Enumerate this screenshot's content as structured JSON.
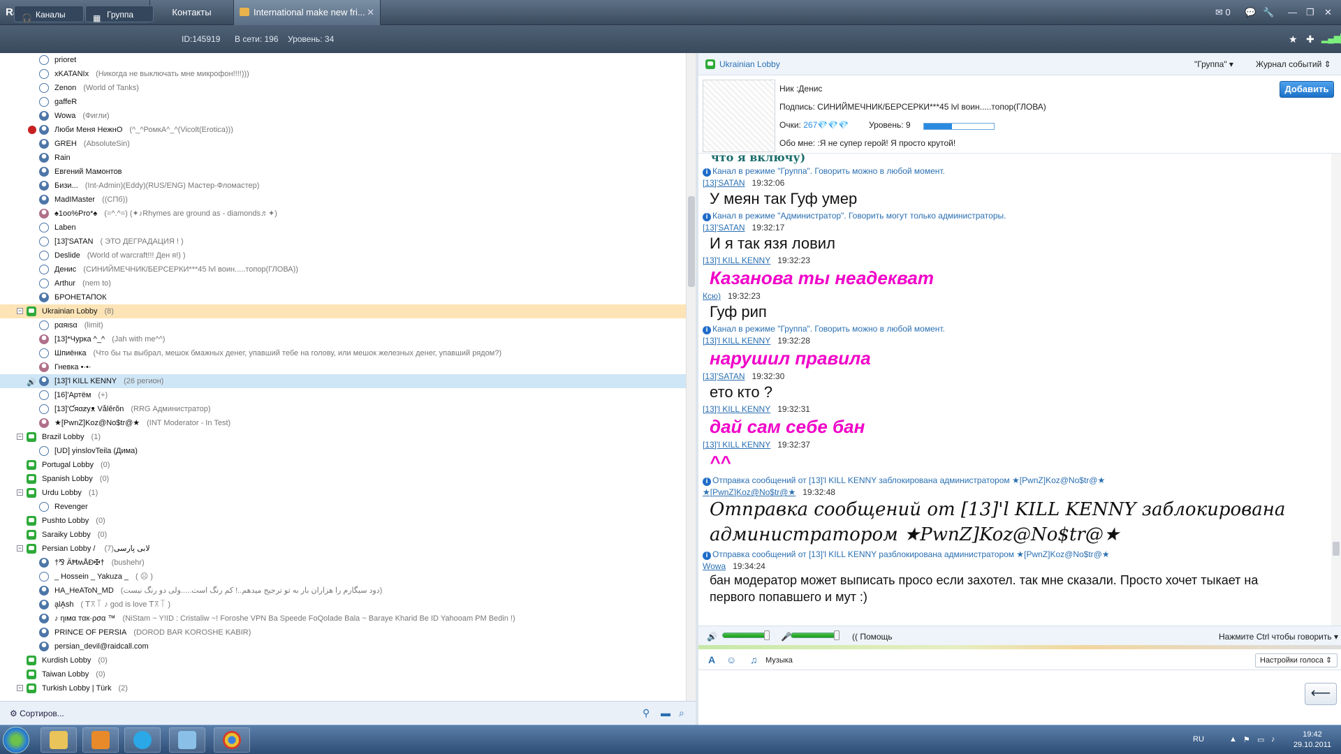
{
  "app": {
    "logo": "RaidCall"
  },
  "tabs": [
    {
      "label": "Группы"
    },
    {
      "label": "Контакты"
    },
    {
      "label": "International make new fri..."
    }
  ],
  "header_icons": {
    "mail_count": "0"
  },
  "sub": {
    "channels_label": "Каналы",
    "group_label": "Группа",
    "id": "ID:145919",
    "online": "В сети: 196",
    "level": "Уровень: 34"
  },
  "tree": [
    {
      "type": "user",
      "indent": 2,
      "style": "o",
      "name": "prioret",
      "note": ""
    },
    {
      "type": "user",
      "indent": 2,
      "style": "o",
      "name": "xKATANIx",
      "note": "(Никогда не выключать мне микрофон!!!!)))"
    },
    {
      "type": "user",
      "indent": 2,
      "style": "o",
      "name": "Zenon",
      "note": "(World of Tanks)"
    },
    {
      "type": "user",
      "indent": 2,
      "style": "o",
      "name": "gaffeR",
      "note": ""
    },
    {
      "type": "user",
      "indent": 2,
      "style": "",
      "name": "Wowa",
      "note": "(Фигли)"
    },
    {
      "type": "user",
      "indent": 2,
      "style": "",
      "name": "Люби Меня НежнО",
      "note": "(^_^РомкА^_^(Vicolt(Erotica)))",
      "blocked": true
    },
    {
      "type": "user",
      "indent": 2,
      "style": "",
      "name": "GREH",
      "note": "(AbsoluteSin)"
    },
    {
      "type": "user",
      "indent": 2,
      "style": "",
      "name": "Rain",
      "note": ""
    },
    {
      "type": "user",
      "indent": 2,
      "style": "",
      "name": "Евгений Мамонтов",
      "note": ""
    },
    {
      "type": "user",
      "indent": 2,
      "style": "",
      "name": "Бизи...",
      "note": "(Int-Admin)(Eddy)(RUS/ENG) Мастер-Фломастер)"
    },
    {
      "type": "user",
      "indent": 2,
      "style": "",
      "name": "MadIMaster",
      "note": "((СПб))"
    },
    {
      "type": "user",
      "indent": 2,
      "style": "p",
      "name": "♠1oo%Pro*♠",
      "note": "(=^.^=) (✦♪Rhymes are ground as - diamonds♬✦)"
    },
    {
      "type": "user",
      "indent": 2,
      "style": "o",
      "name": "Laben",
      "note": ""
    },
    {
      "type": "user",
      "indent": 2,
      "style": "o",
      "name": "[13]'SATAN",
      "note": "( ЭТО ДЕГРАДАЦИЯ ! )"
    },
    {
      "type": "user",
      "indent": 2,
      "style": "o",
      "name": "Deslide",
      "note": "(World of warcraft!!! Ден я!) )"
    },
    {
      "type": "user",
      "indent": 2,
      "style": "o",
      "name": "Денис",
      "note": "(СИНИЙМЕЧНИК/БЕРСЕРКИ***45 lvl воин.....топор(ГЛОВА))"
    },
    {
      "type": "user",
      "indent": 2,
      "style": "o",
      "name": "Arthur",
      "note": "(nem to)"
    },
    {
      "type": "user",
      "indent": 2,
      "style": "",
      "name": "БРОНЕТАПОК",
      "note": ""
    },
    {
      "type": "channel",
      "indent": 1,
      "name": "Ukrainian Lobby",
      "note": "(8)",
      "tw": "⊟",
      "hl": true
    },
    {
      "type": "user",
      "indent": 2,
      "style": "o",
      "name": "рαяιѕα",
      "note": "(limit)"
    },
    {
      "type": "user",
      "indent": 2,
      "style": "p",
      "name": "[13]*Чурка ^_^",
      "note": "(Jah with me^^)"
    },
    {
      "type": "user",
      "indent": 2,
      "style": "o",
      "name": "Шпиёнка",
      "note": "(Что бы ты выбрал, мешок бмажных денег, упавший тебе на голову, или мешок железных денег, упавший рядом?)"
    },
    {
      "type": "user",
      "indent": 2,
      "style": "p",
      "name": "Гневка •·•·",
      "note": ""
    },
    {
      "type": "user",
      "indent": 2,
      "style": "",
      "name": "[13]'l KILL KENNY",
      "note": "(26 регион)",
      "sel": true,
      "speaking": true
    },
    {
      "type": "user",
      "indent": 2,
      "style": "o",
      "name": "[16]'Артём",
      "note": "(+)"
    },
    {
      "type": "user",
      "indent": 2,
      "style": "o",
      "name": "[13]'Ƈяαƶуᴥ Vålêrõn",
      "note": "(RRG Администратор)"
    },
    {
      "type": "user",
      "indent": 2,
      "style": "p",
      "name": "★[PwnZ]Koz@No$tr@★",
      "note": "(INT Moderator - In Test)"
    },
    {
      "type": "channel",
      "indent": 1,
      "name": "Brazil Lobby",
      "note": "(1)",
      "tw": "⊟"
    },
    {
      "type": "user",
      "indent": 2,
      "style": "o",
      "name": "[UD] yinslovTeila (Дима)",
      "note": ""
    },
    {
      "type": "channel",
      "indent": 1,
      "name": "Portugal Lobby",
      "note": "(0)",
      "tw": ""
    },
    {
      "type": "channel",
      "indent": 1,
      "name": "Spanish Lobby",
      "note": "(0)",
      "tw": ""
    },
    {
      "type": "channel",
      "indent": 1,
      "name": "Urdu Lobby",
      "note": "(1)",
      "tw": "⊟"
    },
    {
      "type": "user",
      "indent": 2,
      "style": "o",
      "name": "Revenger",
      "note": ""
    },
    {
      "type": "channel",
      "indent": 1,
      "name": "Pushto Lobby",
      "note": "(0)",
      "tw": ""
    },
    {
      "type": "channel",
      "indent": 1,
      "name": "Saraiky Lobby",
      "note": "(0)",
      "tw": ""
    },
    {
      "type": "channel",
      "indent": 1,
      "name": "Persian Lobby / لابی پارسی",
      "note": "(7)",
      "tw": "⊟"
    },
    {
      "type": "user",
      "indent": 2,
      "style": "",
      "name": "†⅋ ÄĦʍÅĐ✠†",
      "note": "(bushehr)"
    },
    {
      "type": "user",
      "indent": 2,
      "style": "o",
      "name": "_ Hossein _ Yakuza _",
      "note": "( ☹ )"
    },
    {
      "type": "user",
      "indent": 2,
      "style": "",
      "name": "HA_HeAToN_MD",
      "note": "(دود سیگارم را هزاران بار به تو ترجیح میدهم..! کم رنگ است.....ولی دو رنگ نیست)"
    },
    {
      "type": "user",
      "indent": 2,
      "style": "",
      "name": "ḁlḀsh",
      "note": "( ꓔ꓃꓄ ♪ god is love ꓔ꓃꓄ )"
    },
    {
      "type": "user",
      "indent": 2,
      "style": "",
      "name": "♪ ηιмα тαк·ρσα ™",
      "note": "(NiStam ~ Y!ID : Cristaliw ~! Foroshe VPN Ba Speede FoQolade Bala ~ Baraye Kharid Be ID Yahooam PM Bedin !)"
    },
    {
      "type": "user",
      "indent": 2,
      "style": "",
      "name": "PRINCE OF PERSIA",
      "note": "(DOROD BAR KOROSHE KABIR)"
    },
    {
      "type": "user",
      "indent": 2,
      "style": "",
      "name": "persian_devil@raidcall.com",
      "note": ""
    },
    {
      "type": "channel",
      "indent": 1,
      "name": "Kurdish  Lobby",
      "note": "(0)",
      "tw": ""
    },
    {
      "type": "channel",
      "indent": 1,
      "name": "Taiwan Lobby",
      "note": "(0)",
      "tw": ""
    },
    {
      "type": "channel",
      "indent": 1,
      "name": "Turkish Lobby | Türk",
      "note": "(2)",
      "tw": "⊟"
    }
  ],
  "left_bottom": {
    "sort_label": "Сортиров..."
  },
  "right": {
    "channel_name": "Ukrainian Lobby",
    "mode_select": "\"Группа\"",
    "log_select": "Журнал событий",
    "profile": {
      "nick": "Ник :Денис",
      "signature": "Подпись: СИНИЙМЕЧНИК/БЕРСЕРКИ***45 lvl воин.....топор(ГЛОВА)",
      "points_label": "Очки:",
      "points_value": "267💎💎💎",
      "level_label": "Уровень:",
      "level_value": "9",
      "level_progress": 0.4,
      "about": "Обо мне: :Я не супер герой! Я просто крутой!",
      "add_button": "Добавить"
    },
    "chat": [
      {
        "kind": "teal",
        "text": "что я включу)"
      },
      {
        "kind": "sys",
        "text": "Канал в режиме \"Группа\". Говорить можно в любой момент."
      },
      {
        "kind": "meta",
        "who": "[13]'SATAN",
        "time": "19:32:06"
      },
      {
        "kind": "big",
        "text": "У меян так Гуф умер"
      },
      {
        "kind": "sys",
        "text": "Канал в режиме \"Администратор\". Говорить могут только администраторы."
      },
      {
        "kind": "meta",
        "who": "[13]'SATAN",
        "time": "19:32:17"
      },
      {
        "kind": "big",
        "text": "И я так язя ловил"
      },
      {
        "kind": "meta",
        "who": "[13]'l KILL KENNY",
        "time": "19:32:23"
      },
      {
        "kind": "pink",
        "text": "Казанова ты неадекват"
      },
      {
        "kind": "meta",
        "who": "Ксю)",
        "time": "19:32:23"
      },
      {
        "kind": "big",
        "text": "Гуф рип"
      },
      {
        "kind": "sys",
        "text": "Канал в режиме \"Группа\". Говорить можно в любой момент."
      },
      {
        "kind": "meta",
        "who": "[13]'l KILL KENNY",
        "time": "19:32:28"
      },
      {
        "kind": "pink",
        "text": "нарушил правила"
      },
      {
        "kind": "meta",
        "who": "[13]'SATAN",
        "time": "19:32:30"
      },
      {
        "kind": "big",
        "text": "ето кто ?"
      },
      {
        "kind": "meta",
        "who": "[13]'l KILL KENNY",
        "time": "19:32:31"
      },
      {
        "kind": "pink",
        "text": "дай сам себе бан"
      },
      {
        "kind": "meta",
        "who": "[13]'l KILL KENNY",
        "time": "19:32:37"
      },
      {
        "kind": "pink",
        "text": "^^"
      },
      {
        "kind": "sys",
        "text": "Отправка сообщений от [13]'l KILL KENNY  заблокирована администратором ★[PwnZ]Koz@No$tr@★"
      },
      {
        "kind": "meta",
        "who": "★[PwnZ]Koz@No$tr@★",
        "time": "19:32:48"
      },
      {
        "kind": "hand",
        "text": "Отправка сообщений от [13]'l KILL KENNY  заблокирована"
      },
      {
        "kind": "hand2",
        "text": "администратором ★PwnZ]Koz@No$tr@★"
      },
      {
        "kind": "sys",
        "text": "Отправка сообщений от [13]'l KILL KENNY  разблокирована администратором ★[PwnZ]Koz@No$tr@★"
      },
      {
        "kind": "meta",
        "who": "Wowa",
        "time": "19:34:24"
      },
      {
        "kind": "med",
        "text": "бан модератор может выписать просо если захотел. так мне сказали. Просто хочет тыкает на"
      },
      {
        "kind": "med",
        "text": "первого попавшего и мут :)"
      }
    ],
    "voice": {
      "help_label": "Помощь",
      "ptt_label": "Нажмите Ctrl чтобы говорить"
    },
    "input": {
      "music_label": "Музыка",
      "voice_settings": "Настройки голоса"
    }
  },
  "taskbar": {
    "lang": "RU",
    "time": "19:42",
    "date": "29.10.2011"
  }
}
